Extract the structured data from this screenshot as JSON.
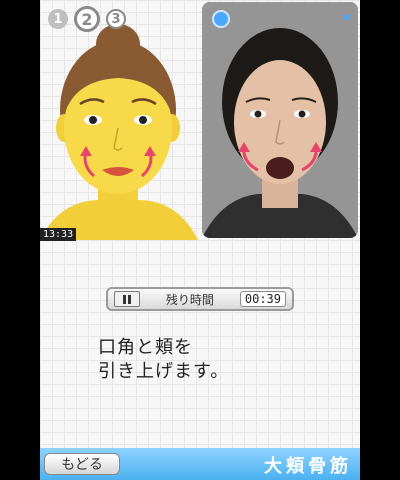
{
  "steps": [
    "1",
    "2",
    "3"
  ],
  "clock": "13:33",
  "timer": {
    "label": "残り時間",
    "value": "00:39"
  },
  "instruction": {
    "line1": "口角と頬を",
    "line2": "引き上げます。"
  },
  "back_button": "もどる",
  "mode_title": "大頬骨筋",
  "colors": {
    "accent": "#4ab1f0",
    "arrow": "#e8456b",
    "skin": "#f7d94a"
  }
}
